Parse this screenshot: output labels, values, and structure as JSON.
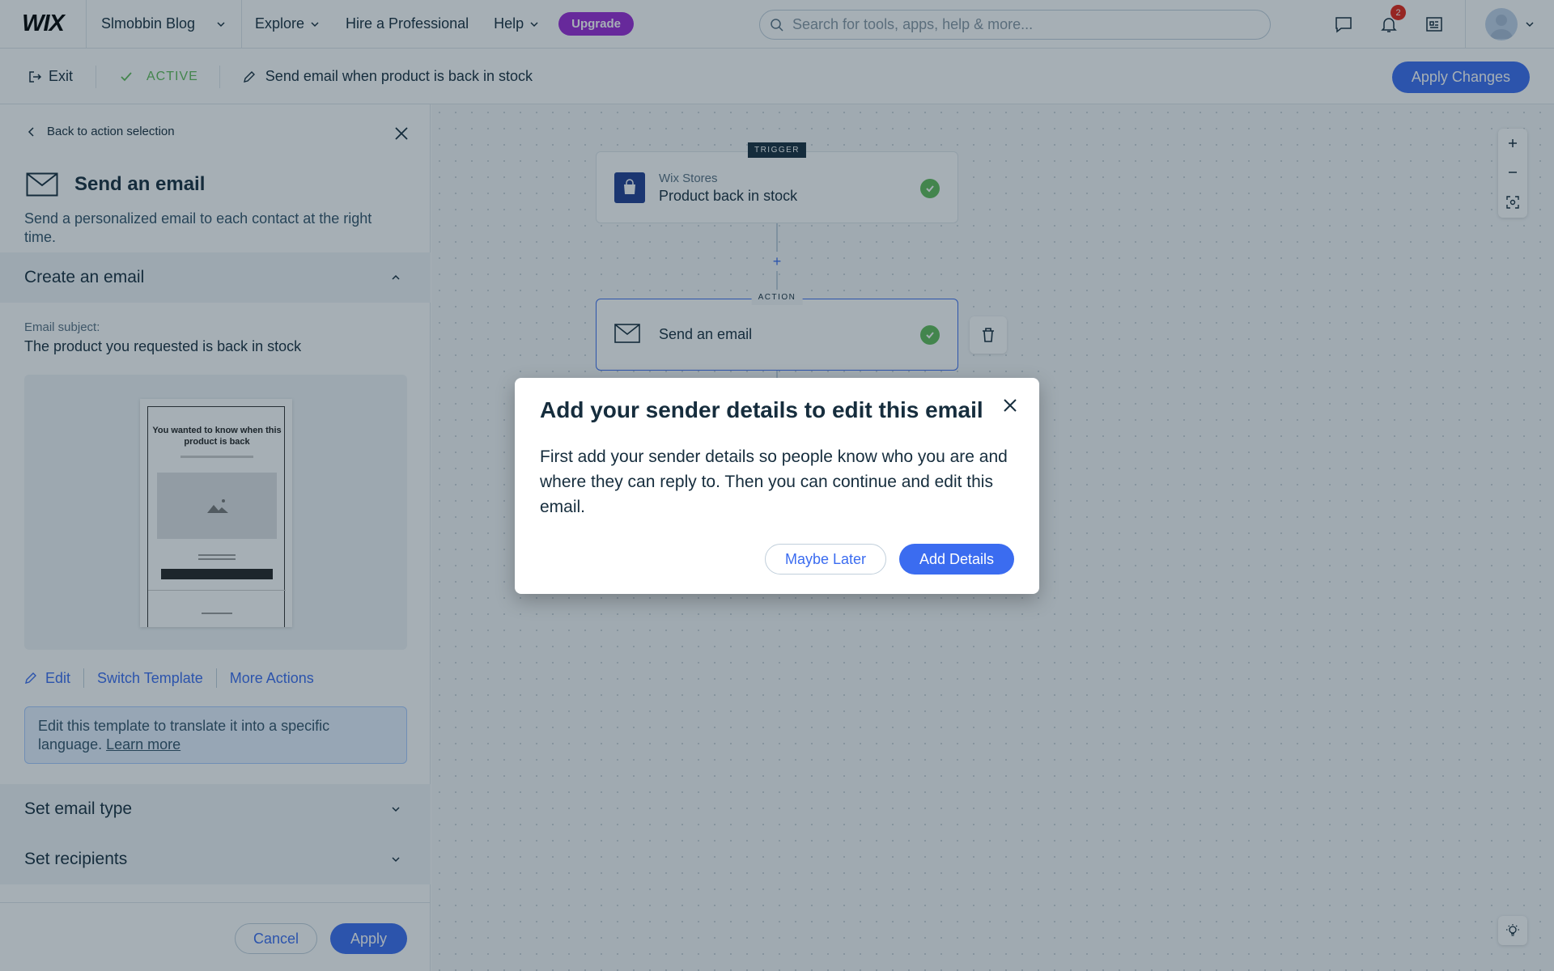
{
  "topbar": {
    "logo": "WIX",
    "site_name": "Slmobbin Blog",
    "nav": [
      {
        "label": "Explore"
      },
      {
        "label": "Hire a Professional"
      },
      {
        "label": "Help"
      }
    ],
    "upgrade_label": "Upgrade",
    "search_placeholder": "Search for tools, apps, help & more...",
    "notification_count": "2"
  },
  "subbar": {
    "exit_label": "Exit",
    "status_label": "ACTIVE",
    "automation_title": "Send email when product is back in stock",
    "apply_changes_label": "Apply Changes"
  },
  "panel": {
    "back_label": "Back to action selection",
    "title": "Send an email",
    "description": "Send a personalized email to each contact at the right time.",
    "create_section": "Create an email",
    "subject_label": "Email subject:",
    "subject_value": "The product you requested is back in stock",
    "preview": {
      "heading": "You wanted to know when this product is back"
    },
    "actions": {
      "edit": "Edit",
      "switch": "Switch Template",
      "more": "More Actions"
    },
    "note_text": "Edit this template to translate it into a specific language.",
    "note_link": "Learn more",
    "email_type_section": "Set email type",
    "recipients_section": "Set recipients",
    "cancel_label": "Cancel",
    "apply_label": "Apply"
  },
  "canvas": {
    "trigger": {
      "tag": "TRIGGER",
      "app": "Wix Stores",
      "name": "Product back in stock"
    },
    "action": {
      "tag": "ACTION",
      "name": "Send an email"
    }
  },
  "modal": {
    "title": "Add your sender details to edit this email",
    "body": "First add your sender details so people know who you are and where they can reply to. Then you can continue and edit this email.",
    "later_label": "Maybe Later",
    "add_label": "Add Details"
  },
  "colors": {
    "primary": "#3b6cf0",
    "upgrade": "#9a27d5",
    "success": "#60bc57",
    "text": "#162d3d"
  }
}
